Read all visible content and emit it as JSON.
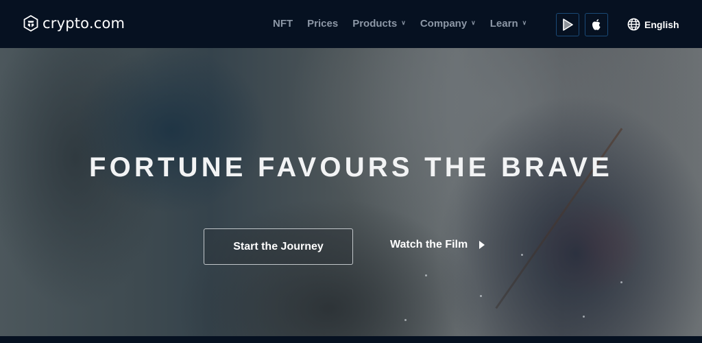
{
  "header": {
    "logo_text": "crypto.com",
    "nav": [
      {
        "label": "NFT",
        "has_dropdown": false
      },
      {
        "label": "Prices",
        "has_dropdown": false
      },
      {
        "label": "Products",
        "has_dropdown": true
      },
      {
        "label": "Company",
        "has_dropdown": true
      },
      {
        "label": "Learn",
        "has_dropdown": true
      }
    ],
    "app_buttons": [
      {
        "icon": "google-play-icon"
      },
      {
        "icon": "apple-icon"
      }
    ],
    "language": {
      "icon": "globe-icon",
      "label": "English"
    },
    "dropdown_glyph": "⌄"
  },
  "hero": {
    "title": "FORTUNE FAVOURS THE BRAVE",
    "primary_cta": "Start the Journey",
    "secondary_cta": "Watch the Film",
    "secondary_cta_icon": "play-icon"
  },
  "colors": {
    "header_bg": "#061121",
    "nav_text": "#8c97a6",
    "app_button_border": "#1a4a78",
    "hero_text": "#f2f3f4"
  }
}
